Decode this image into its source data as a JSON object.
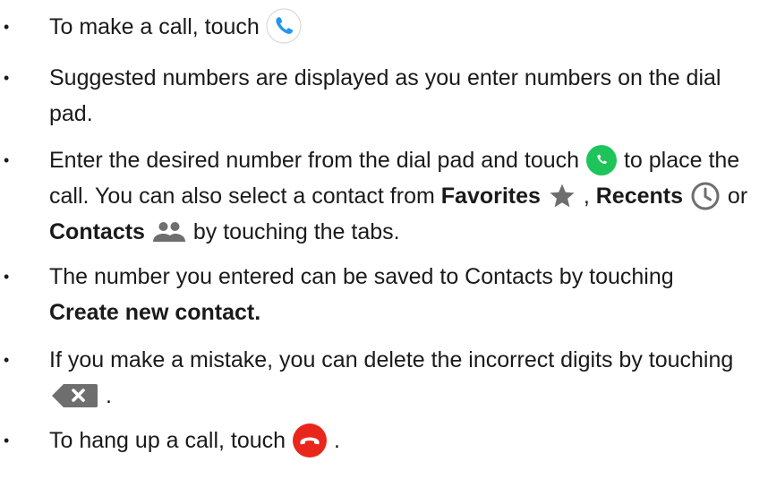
{
  "items": [
    {
      "a": "To make a call, touch"
    },
    {
      "a": "Suggested numbers are displayed as you enter numbers on the dial pad."
    },
    {
      "a": "Enter the desired number from the dial pad and touch",
      "b": "to place the call. You can also select a contact from",
      "favorites": "Favorites",
      "comma": ",",
      "recents": "Recents",
      "or": "or",
      "contacts": "Contacts",
      "c": "by touching the tabs."
    },
    {
      "a": "The number you entered can be saved to Contacts by touching",
      "create": "Create new contact."
    },
    {
      "a": "If you make a mistake, you can delete the incorrect digits by touching",
      "end": "."
    },
    {
      "a": "To hang up a call, touch",
      "end": "."
    }
  ],
  "icons": {
    "phone": "phone-icon",
    "call_green": "call-button-icon",
    "favorites": "star-icon",
    "recents": "clock-icon",
    "contacts": "people-icon",
    "delete": "backspace-icon",
    "hang_up": "end-call-icon"
  },
  "colors": {
    "phone_blue": "#2196f3",
    "call_green": "#1ec45a",
    "icon_gray": "#6e6e6e",
    "hang_up_red": "#e8261c"
  }
}
